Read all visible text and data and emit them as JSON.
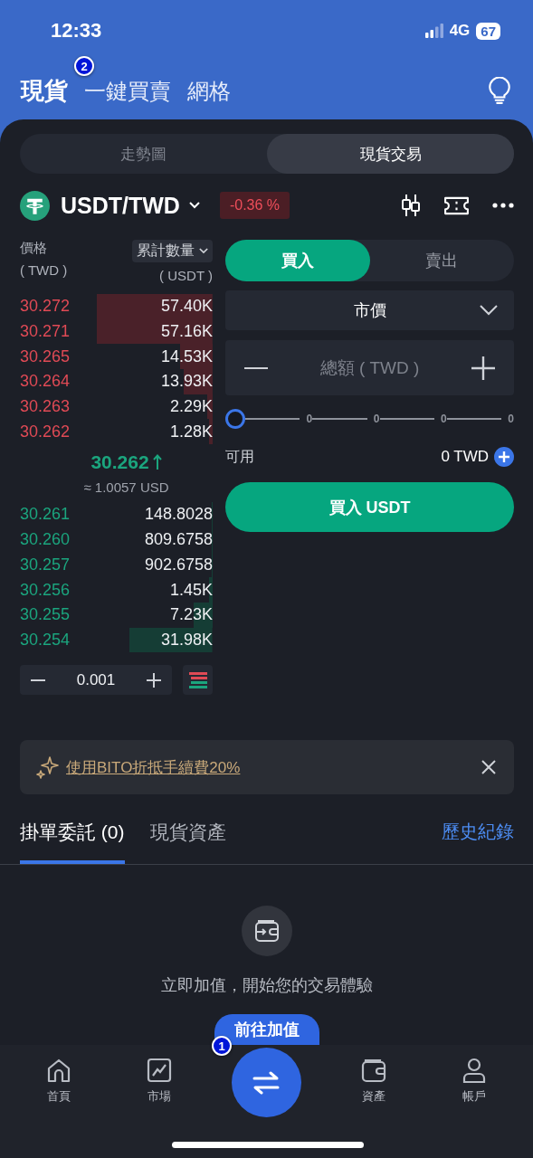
{
  "status_bar": {
    "time": "12:33",
    "network": "4G",
    "battery": "67"
  },
  "header": {
    "tabs": [
      {
        "label": "現貨",
        "selected": true
      },
      {
        "label": "一鍵買賣",
        "selected": false
      },
      {
        "label": "網格",
        "selected": false
      }
    ]
  },
  "view_switch": [
    {
      "label": "走勢圖",
      "selected": false
    },
    {
      "label": "現貨交易",
      "selected": true
    }
  ],
  "pair": {
    "name": "USDT/TWD",
    "change": "-0.36 %"
  },
  "order_book": {
    "price_header": "價格",
    "price_unit": "( TWD )",
    "amount_header": "累計數量",
    "amount_unit": "( USDT )",
    "asks": [
      {
        "price": "30.272",
        "amount": "57.40K"
      },
      {
        "price": "30.271",
        "amount": "57.16K"
      },
      {
        "price": "30.265",
        "amount": "14.53K"
      },
      {
        "price": "30.264",
        "amount": "13.93K"
      },
      {
        "price": "30.263",
        "amount": "2.29K"
      },
      {
        "price": "30.262",
        "amount": "1.28K"
      }
    ],
    "last_price": "30.262",
    "last_price_usd": "≈ 1.0057 USD",
    "bids": [
      {
        "price": "30.261",
        "amount": "148.8028"
      },
      {
        "price": "30.260",
        "amount": "809.6758"
      },
      {
        "price": "30.257",
        "amount": "902.6758"
      },
      {
        "price": "30.256",
        "amount": "1.45K"
      },
      {
        "price": "30.255",
        "amount": "7.23K"
      },
      {
        "price": "30.254",
        "amount": "31.98K"
      }
    ],
    "step": "0.001"
  },
  "order_form": {
    "sides": [
      {
        "label": "買入",
        "selected": true
      },
      {
        "label": "賣出",
        "selected": false
      }
    ],
    "order_type": "市價",
    "amount_placeholder": "總額 ( TWD )",
    "slider": {
      "level": 0,
      "ticks": [
        "0",
        "0",
        "0",
        "0"
      ]
    },
    "available_label": "可用",
    "available_value": "0 TWD",
    "submit": "買入 USDT"
  },
  "promo": {
    "text": "使用BITO折抵手續費20%"
  },
  "orders": {
    "tabs": [
      {
        "label": "掛單委託 (0)",
        "selected": true
      },
      {
        "label": "現貨資產",
        "selected": false
      }
    ],
    "history": "歷史紀錄",
    "empty_text": "立即加值，開始您的交易體驗",
    "deposit_button": "前往加值"
  },
  "bottom_nav": [
    {
      "kind": "home",
      "label": "首頁"
    },
    {
      "kind": "market",
      "label": "市場"
    },
    {
      "kind": "trade"
    },
    {
      "kind": "assets",
      "label": "資產"
    },
    {
      "kind": "account",
      "label": "帳戶"
    }
  ],
  "annotations": [
    "1",
    "2"
  ]
}
